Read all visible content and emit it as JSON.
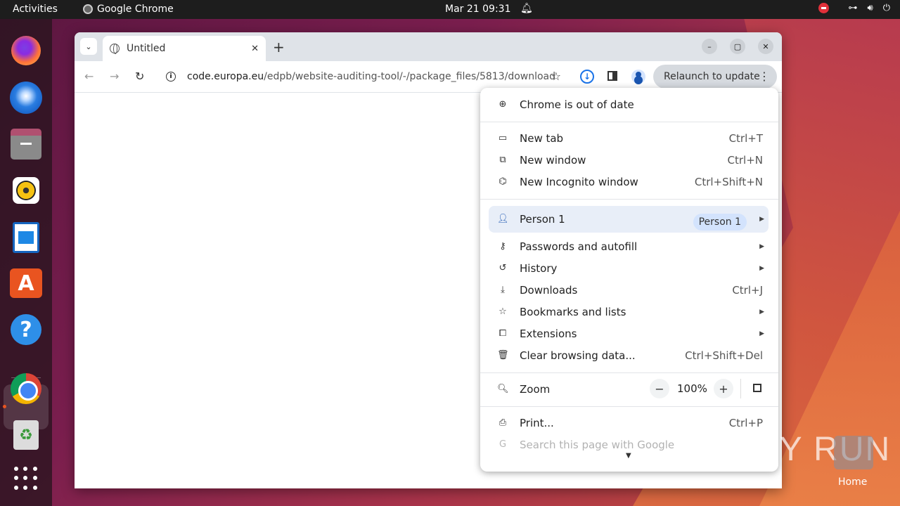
{
  "topbar": {
    "activities": "Activities",
    "app_name": "Google Chrome",
    "clock": "Mar 21  09:31"
  },
  "window": {
    "tab_title": "Untitled",
    "url_domain": "code.europa.eu",
    "url_path": "/edpb/website-auditing-tool/-/package_files/5813/download",
    "relaunch_label": "Relaunch to update"
  },
  "menu": {
    "out_of_date": "Chrome is out of date",
    "items": [
      {
        "label": "New tab",
        "shortcut": "Ctrl+T"
      },
      {
        "label": "New window",
        "shortcut": "Ctrl+N"
      },
      {
        "label": "New Incognito window",
        "shortcut": "Ctrl+Shift+N"
      }
    ],
    "person_label": "Person 1",
    "person_badge": "Person 1",
    "items2": [
      {
        "label": "Passwords and autofill",
        "shortcut": ""
      },
      {
        "label": "History",
        "shortcut": ""
      },
      {
        "label": "Downloads",
        "shortcut": "Ctrl+J"
      },
      {
        "label": "Bookmarks and lists",
        "shortcut": ""
      },
      {
        "label": "Extensions",
        "shortcut": ""
      },
      {
        "label": "Clear browsing data...",
        "shortcut": "Ctrl+Shift+Del"
      }
    ],
    "zoom_label": "Zoom",
    "zoom_minus": "−",
    "zoom_value": "100%",
    "zoom_plus": "+",
    "print_label": "Print...",
    "print_shortcut": "Ctrl+P",
    "search_label": "Search this page with Google"
  },
  "desktop": {
    "watermark": "ANY RUN",
    "home_label": "Home"
  }
}
